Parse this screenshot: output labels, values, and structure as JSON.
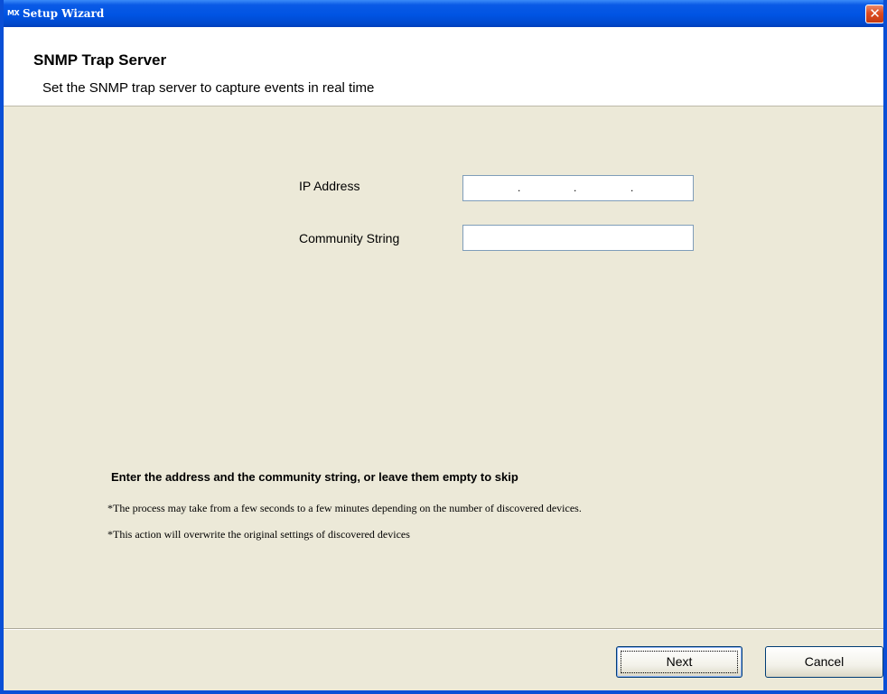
{
  "window": {
    "title": "Setup Wizard",
    "icon_text": "MX",
    "close_glyph": "✕",
    "brand_color": "#0054e3"
  },
  "header": {
    "title": "SNMP Trap Server",
    "subtitle": "Set the SNMP trap server to capture events in real time"
  },
  "form": {
    "ip_label": "IP Address",
    "ip_value": "",
    "ip_separator": ".",
    "community_label": "Community String",
    "community_value": ""
  },
  "notes": {
    "heading": "Enter the address and the community string, or leave them empty to skip",
    "line1": "*The process may take from a few seconds to a few minutes depending on the number of discovered devices.",
    "line2": "*This action will overwrite the original settings of discovered devices"
  },
  "buttons": {
    "next": "Next",
    "cancel": "Cancel"
  }
}
